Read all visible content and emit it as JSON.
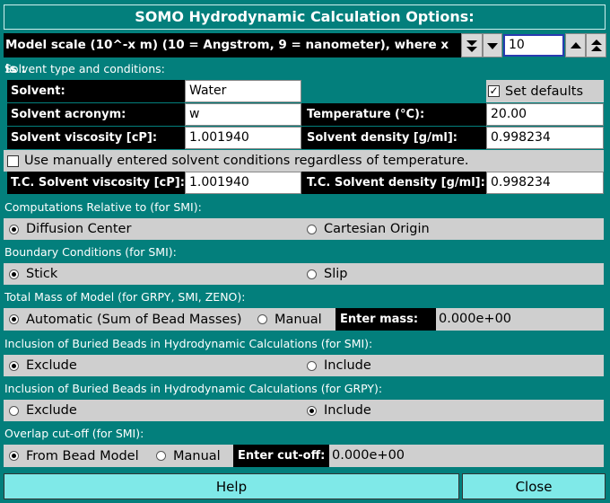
{
  "title": "SOMO Hydrodynamic Calculation Options:",
  "model_scale": {
    "label": "Model scale (10^-x m) (10 = Angstrom, 9 = nanometer), where x is :",
    "value": "10"
  },
  "solvent": {
    "section_label": "Solvent type and conditions:",
    "solvent_label": "Solvent:",
    "solvent_value": "Water",
    "set_defaults_label": "Set defaults",
    "set_defaults_checked": true,
    "acronym_label": "Solvent acronym:",
    "acronym_value": "w",
    "temperature_label": "Temperature (°C):",
    "temperature_value": "20.00",
    "viscosity_label": "Solvent viscosity [cP]:",
    "viscosity_value": "1.001940",
    "density_label": "Solvent density [g/ml]:",
    "density_value": "0.998234",
    "manual_conditions_label": "Use manually entered solvent conditions regardless of temperature.",
    "manual_conditions_checked": false,
    "tc_viscosity_label": "T.C. Solvent viscosity [cP]:",
    "tc_viscosity_value": "1.001940",
    "tc_density_label": "T.C. Solvent density [g/ml]:",
    "tc_density_value": "0.998234"
  },
  "computations": {
    "label": "Computations Relative to (for SMI):",
    "opt1": "Diffusion Center",
    "opt2": "Cartesian Origin",
    "selected": "opt1"
  },
  "boundary": {
    "label": "Boundary Conditions (for SMI):",
    "opt1": "Stick",
    "opt2": "Slip",
    "selected": "opt1"
  },
  "mass": {
    "label": "Total Mass of Model (for GRPY, SMI, ZENO):",
    "opt1": "Automatic (Sum of Bead Masses)",
    "opt2": "Manual",
    "selected": "opt1",
    "enter_label": "Enter mass:",
    "enter_value": "0.000e+00"
  },
  "buried_smi": {
    "label": "Inclusion of Buried Beads in Hydrodynamic Calculations (for SMI):",
    "opt1": "Exclude",
    "opt2": "Include",
    "selected": "opt1"
  },
  "buried_grpy": {
    "label": "Inclusion of Buried Beads in Hydrodynamic Calculations (for GRPY):",
    "opt1": "Exclude",
    "opt2": "Include",
    "selected": "opt2"
  },
  "overlap": {
    "label": "Overlap cut-off (for SMI):",
    "opt1": "From Bead Model",
    "opt2": "Manual",
    "selected": "opt1",
    "enter_label": "Enter cut-off:",
    "enter_value": "0.000e+00"
  },
  "buttons": {
    "help": "Help",
    "close": "Close"
  }
}
